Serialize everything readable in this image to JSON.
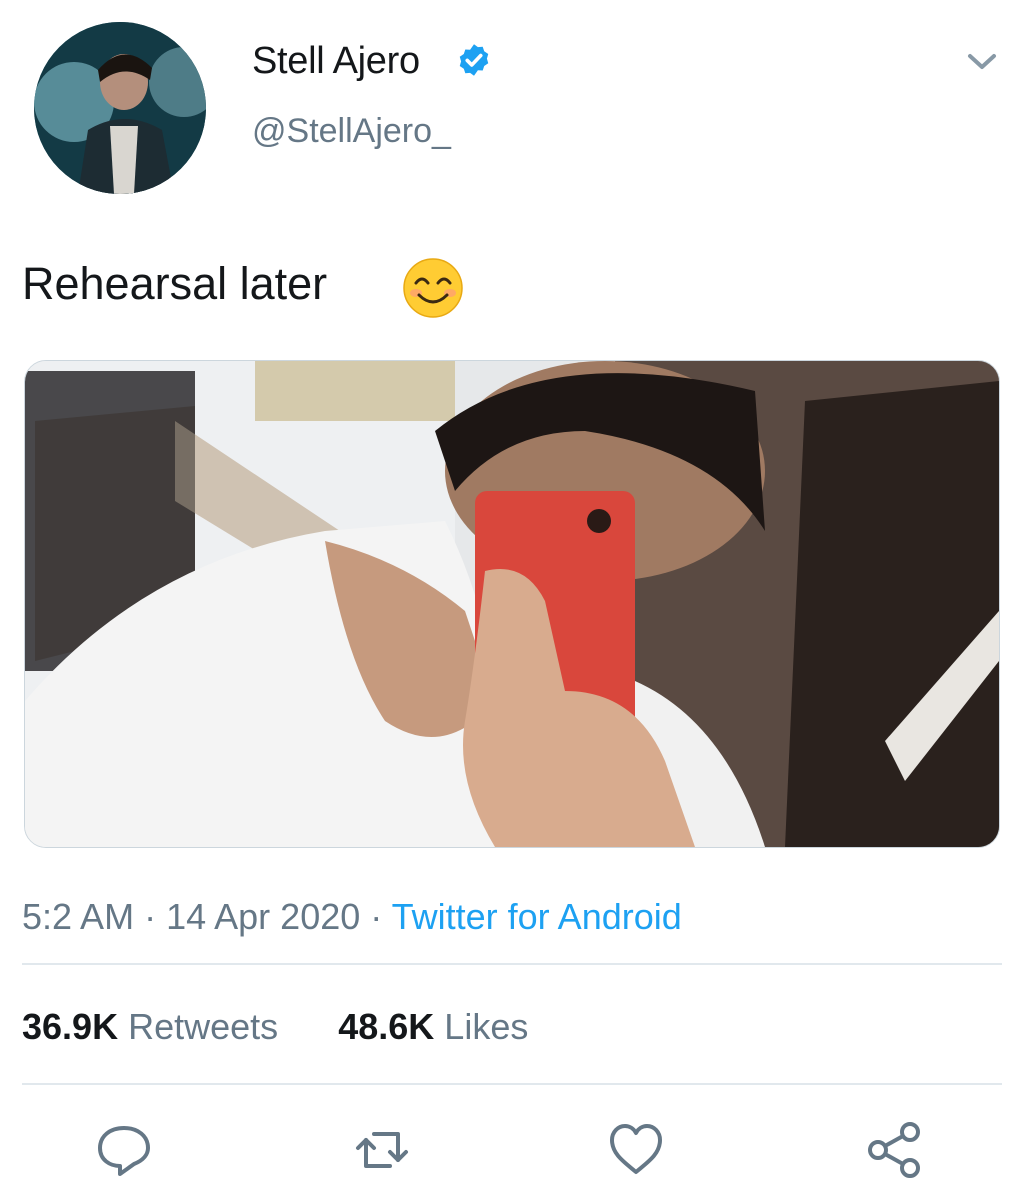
{
  "tweet": {
    "display_name": "Stell Ajero",
    "handle": "@StellAjero_",
    "text": "Rehearsal later",
    "time": "5:2 AM",
    "date": "14 Apr 2020",
    "source": "Twitter for Android",
    "separator": "·"
  },
  "stats": {
    "retweets_count": "36.9K",
    "retweets_label": "Retweets",
    "likes_count": "48.6K",
    "likes_label": "Likes"
  },
  "actions": {
    "icons": [
      "reply-icon",
      "retweet-icon",
      "like-icon",
      "share-icon"
    ]
  },
  "colors": {
    "verified": "#1da1f2",
    "link": "#1da1f2",
    "secondary_text": "#657786",
    "divider": "#e1e8ed"
  }
}
